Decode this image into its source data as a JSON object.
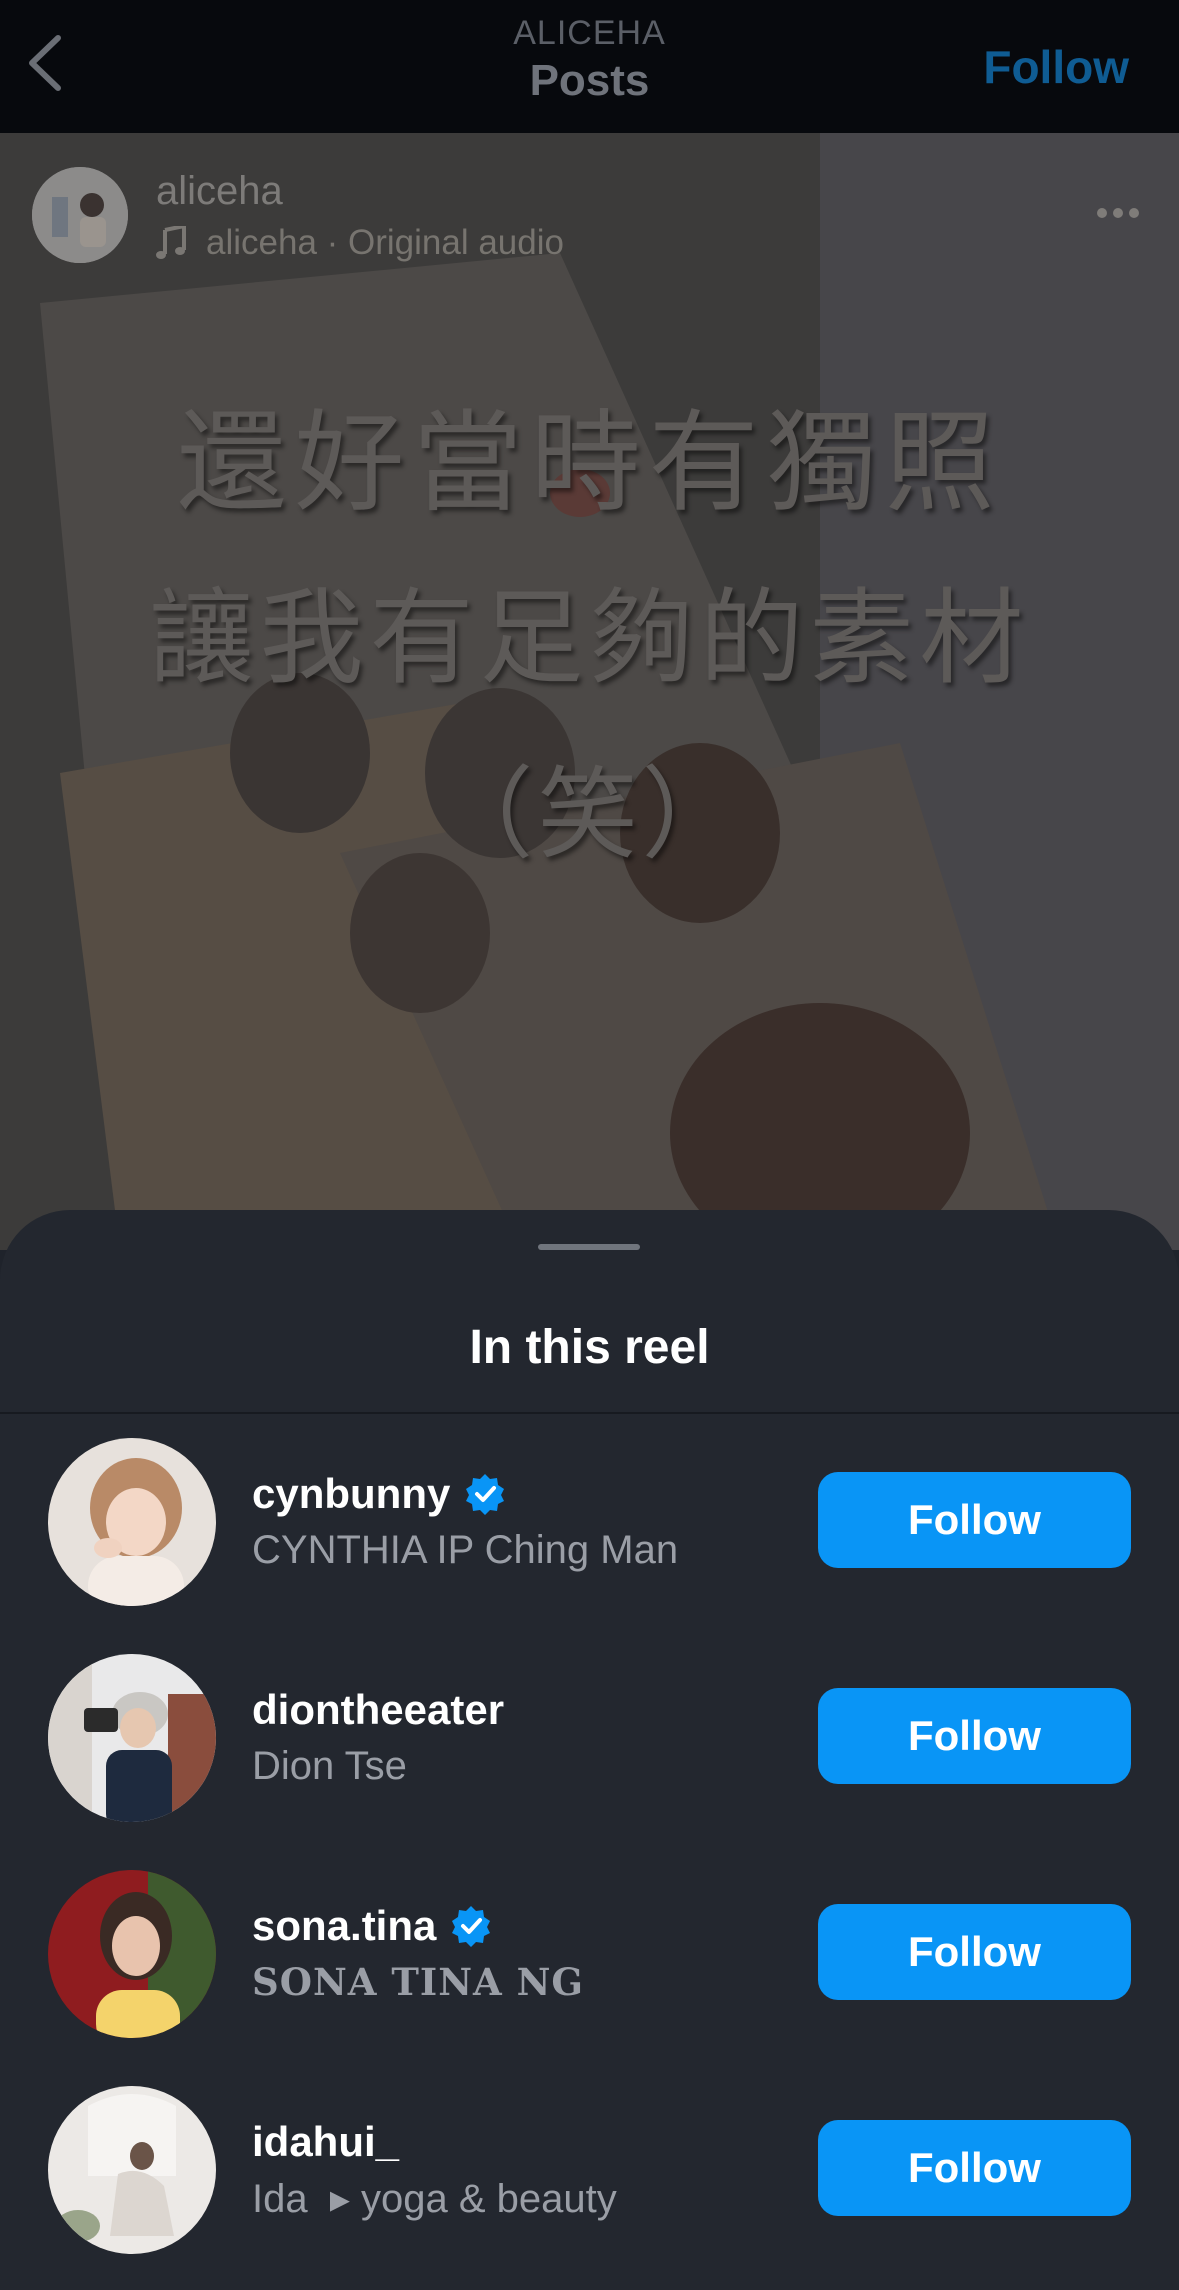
{
  "header": {
    "username": "ALICEHA",
    "section": "Posts",
    "follow_label": "Follow"
  },
  "post": {
    "username": "aliceha",
    "audio": "aliceha · Original audio",
    "overlay_lines": [
      "還好當時有獨照",
      "讓我有足夠的素材",
      "（笑）"
    ]
  },
  "sheet": {
    "title": "In this reel",
    "people": [
      {
        "username": "cynbunny",
        "full_name": "CYNTHIA IP Ching Man",
        "verified": true,
        "follow_label": "Follow"
      },
      {
        "username": "diontheeater",
        "full_name": "Dion Tse",
        "verified": false,
        "follow_label": "Follow"
      },
      {
        "username": "sona.tina",
        "full_name": "SONA TINA NG",
        "verified": true,
        "follow_label": "Follow"
      },
      {
        "username": "idahui_",
        "full_name": "Ida  ▸ yoga & beauty",
        "verified": false,
        "follow_label": "Follow"
      }
    ]
  },
  "colors": {
    "accent": "#0995f6",
    "sheet_bg": "#23272f",
    "header_bg": "#07090d",
    "secondary_text": "#9a9ea6"
  },
  "icons": [
    "chevron-left-icon",
    "music-note-icon",
    "more-horizontal-icon",
    "verified-badge-icon"
  ]
}
